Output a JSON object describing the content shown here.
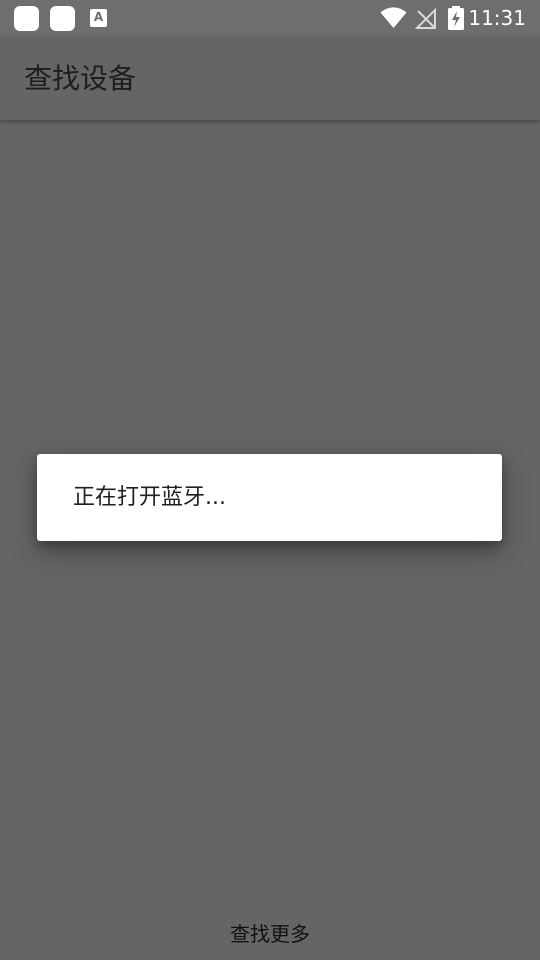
{
  "status_bar": {
    "time": "11:31",
    "notification_icons": [
      "app-notification-icon",
      "app-notification-icon",
      "text-a-icon"
    ],
    "notification_a_glyph": "A",
    "system_icons": [
      "wifi-icon",
      "no-signal-icon",
      "battery-charging-icon"
    ]
  },
  "app_bar": {
    "title": "查找设备"
  },
  "dialog": {
    "message": "正在打开蓝牙..."
  },
  "bottom": {
    "action_label": "查找更多"
  },
  "colors": {
    "scrim_background": "#656565",
    "status_bar": "#6e6e6e",
    "dialog_background": "#ffffff",
    "title_text": "#1e1e1e"
  }
}
